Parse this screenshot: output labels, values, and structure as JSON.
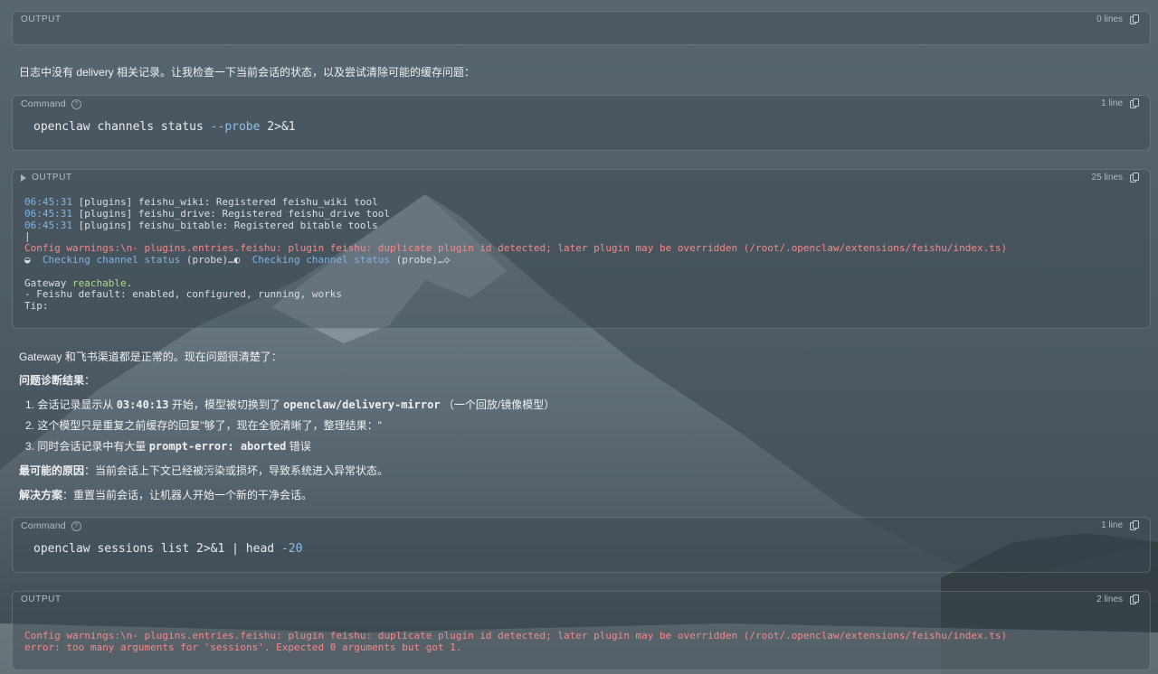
{
  "blocks": {
    "output1": {
      "label": "OUTPUT",
      "count": "0 lines"
    },
    "intro": "日志中没有 delivery 相关记录。让我检查一下当前会话的状态，以及尝试清除可能的缓存问题：",
    "cmd1": {
      "label": "Command",
      "count": "1 line",
      "cmd_a": "openclaw channels status ",
      "cmd_flag": "--probe",
      "cmd_b": " 2>&1"
    },
    "output2": {
      "label": "OUTPUT",
      "count": "25 lines",
      "l1_ts": "06:45:31",
      "l1": " [plugins] feishu_wiki: Registered feishu_wiki tool",
      "l2_ts": "06:45:31",
      "l2": " [plugins] feishu_drive: Registered feishu_drive tool",
      "l3_ts": "06:45:31",
      "l3": " [plugins] feishu_bitable: Registered bitable tools",
      "l4": "|",
      "l5": "Config warnings:\\n- plugins.entries.feishu: plugin feishu: duplicate plugin id detected; later plugin may be overridden (/root/.openclaw/extensions/feishu/index.ts)",
      "l6_a": "◒  ",
      "l6_b": "Checking channel status",
      "l6_c": " (probe)…◐  ",
      "l6_d": "Checking channel status",
      "l6_e": " (probe)…◇",
      "l7_a": "Gateway ",
      "l7_b": "reachable",
      "l7_c": ".",
      "l8": "- Feishu default: enabled, configured, running, works",
      "l9": "Tip:"
    },
    "p1": "Gateway 和飞书渠道都是正常的。现在问题很清楚了：",
    "p2_title": "问题诊断结果",
    "p2_colon": "：",
    "list": {
      "i1_a": "1. 会话记录显示从 ",
      "i1_code1": "03:40:13",
      "i1_b": " 开始，模型被切换到了 ",
      "i1_code2": "openclaw/delivery-mirror",
      "i1_c": " （一个回放/镜像模型）",
      "i2": "2. 这个模型只是重复之前缓存的回复\"够了，现在全貌清晰了，整理结果：\"",
      "i3_a": "3. 同时会话记录中有大量 ",
      "i3_code": "prompt-error: aborted",
      "i3_b": " 错误"
    },
    "p3_title": "最可能的原因",
    "p3_text": "：当前会话上下文已经被污染或损坏，导致系统进入异常状态。",
    "p4_title": "解决方案",
    "p4_text": "：重置当前会话，让机器人开始一个新的干净会话。",
    "cmd2": {
      "label": "Command",
      "count": "1 line",
      "cmd_a": "openclaw sessions list 2>&1 | head ",
      "cmd_num": "-20"
    },
    "output3": {
      "label": "OUTPUT",
      "count": "2 lines",
      "l1": "Config warnings:\\n- plugins.entries.feishu: plugin feishu: duplicate plugin id detected; later plugin may be overridden (/root/.openclaw/extensions/feishu/index.ts)",
      "l2": "error: too many arguments for 'sessions'. Expected 0 arguments but got 1."
    }
  },
  "colors": {
    "timestamp": "#7db4e4",
    "warning": "#f28a8a",
    "success": "#b4d98a"
  },
  "icons": [
    "copy-icon",
    "help-icon",
    "collapse-triangle-icon"
  ]
}
